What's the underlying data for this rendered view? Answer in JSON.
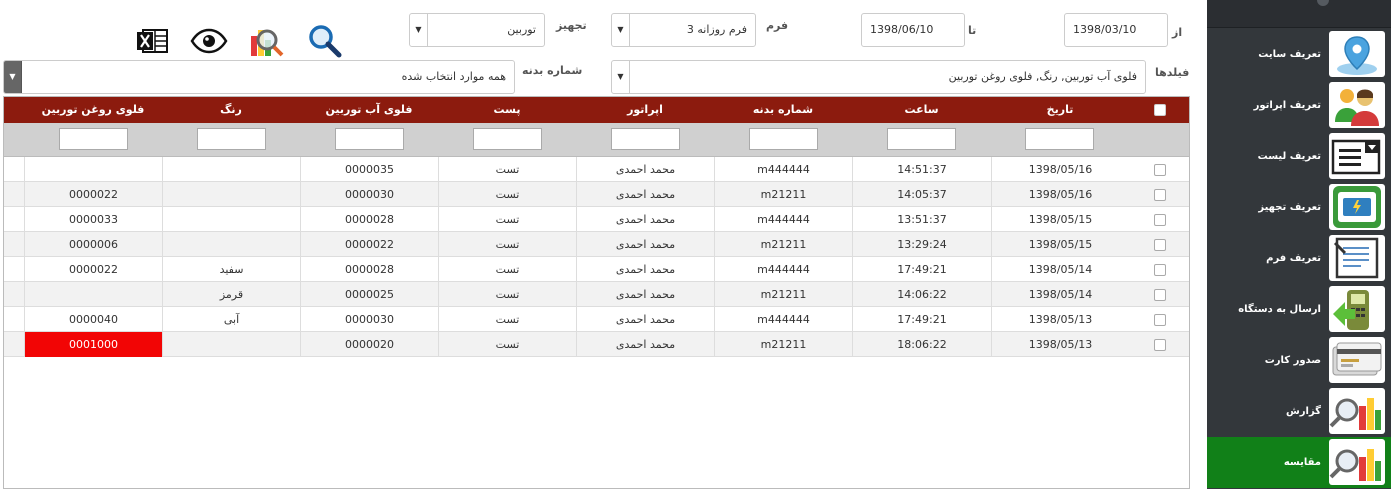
{
  "sidebar": {
    "items": [
      {
        "label": "تعریف سایت",
        "icon": "map-pin-icon",
        "active": false
      },
      {
        "label": "تعریف اپراتور",
        "icon": "users-icon",
        "active": false
      },
      {
        "label": "تعریف لیست",
        "icon": "list-dropdown-icon",
        "active": false
      },
      {
        "label": "تعریف تجهیز",
        "icon": "generator-icon",
        "active": false
      },
      {
        "label": "تعریف فرم",
        "icon": "form-icon",
        "active": false
      },
      {
        "label": "ارسال به دستگاه",
        "icon": "handheld-device-icon",
        "active": false
      },
      {
        "label": "صدور کارت",
        "icon": "card-icon",
        "active": false
      },
      {
        "label": "گزارش",
        "icon": "report-chart-icon",
        "active": false
      },
      {
        "label": "مقایسه",
        "icon": "compare-chart-icon",
        "active": true
      }
    ],
    "active_color": "#118018"
  },
  "filters": {
    "from_label": "از",
    "from_value": "1398/03/10",
    "to_label": "تا",
    "to_value": "1398/06/10",
    "form_label": "فرم",
    "form_value": "فرم روزانه 3",
    "equipment_label": "تجهیز",
    "equipment_value": "توربین",
    "fields_label": "فیلدها",
    "fields_value": "فلوی آب توربین, رنگ, فلوی روغن توربین",
    "body_no_label": "شماره بدنه",
    "body_no_value": "همه موارد انتخاب شده"
  },
  "toolbar": {
    "icons": [
      "excel-export-icon",
      "eye-icon",
      "chart-search-icon",
      "search-icon"
    ]
  },
  "table": {
    "header_color": "#8c1b0e",
    "columns": [
      "تاریخ",
      "ساعت",
      "شماره بدنه",
      "اپراتور",
      "پست",
      "فلوی آب توربین",
      "رنگ",
      "فلوی روغن توربین"
    ],
    "rows": [
      [
        "1398/05/16",
        "14:51:37",
        "m444444",
        "محمد احمدی",
        "تست",
        "0000035",
        "",
        ""
      ],
      [
        "1398/05/16",
        "14:05:37",
        "m21211",
        "محمد احمدی",
        "تست",
        "0000030",
        "",
        "0000022"
      ],
      [
        "1398/05/15",
        "13:51:37",
        "m444444",
        "محمد احمدی",
        "تست",
        "0000028",
        "",
        "0000033"
      ],
      [
        "1398/05/15",
        "13:29:24",
        "m21211",
        "محمد احمدی",
        "تست",
        "0000022",
        "",
        "0000006"
      ],
      [
        "1398/05/14",
        "17:49:21",
        "m444444",
        "محمد احمدی",
        "تست",
        "0000028",
        "سفید",
        "0000022"
      ],
      [
        "1398/05/14",
        "14:06:22",
        "m21211",
        "محمد احمدی",
        "تست",
        "0000025",
        "قرمز",
        ""
      ],
      [
        "1398/05/13",
        "17:49:21",
        "m444444",
        "محمد احمدی",
        "تست",
        "0000030",
        "آبی",
        "0000040"
      ],
      [
        "1398/05/13",
        "18:06:22",
        "m21211",
        "محمد احمدی",
        "تست",
        "0000020",
        "",
        "0001000"
      ]
    ],
    "highlight": {
      "row": 7,
      "col": 7,
      "color": "#f20505"
    }
  }
}
